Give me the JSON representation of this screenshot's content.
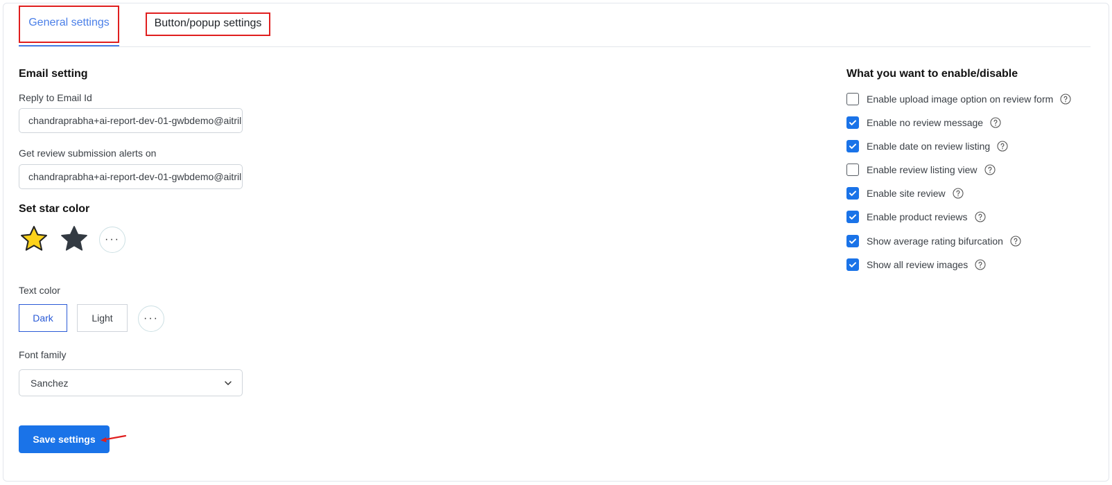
{
  "tabs": [
    {
      "label": "General settings",
      "active": true
    },
    {
      "label": "Button/popup settings",
      "active": false
    }
  ],
  "email": {
    "section_title": "Email setting",
    "reply_label": "Reply to Email Id",
    "reply_value": "chandraprabha+ai-report-dev-01-gwbdemo@aitrilli",
    "alerts_label": "Get review submission alerts on",
    "alerts_value": "chandraprabha+ai-report-dev-01-gwbdemo@aitrilli"
  },
  "star_color": {
    "title": "Set star color",
    "options": [
      {
        "icon": "star-outline-icon",
        "fill": "#fcd21c"
      },
      {
        "icon": "star-filled-icon",
        "fill": "#333a42"
      }
    ],
    "more": "···"
  },
  "text_color": {
    "label": "Text color",
    "options": [
      "Dark",
      "Light"
    ],
    "selected": "Dark",
    "more": "···"
  },
  "font_family": {
    "label": "Font family",
    "value": "Sanchez"
  },
  "save_label": "Save settings",
  "toggles": {
    "title": "What you want to enable/disable",
    "items": [
      {
        "label": "Enable upload image option on review form",
        "checked": false
      },
      {
        "label": "Enable no review message",
        "checked": true
      },
      {
        "label": "Enable date on review listing",
        "checked": true
      },
      {
        "label": "Enable review listing view",
        "checked": false
      },
      {
        "label": "Enable site review",
        "checked": true
      },
      {
        "label": "Enable product reviews",
        "checked": true
      },
      {
        "label": "Show average rating bifurcation",
        "checked": true
      },
      {
        "label": "Show all review images",
        "checked": true
      }
    ]
  },
  "colors": {
    "accent": "#1a73e8",
    "tab_active": "#4a7fe8",
    "annotation_red": "#e01e1e"
  }
}
